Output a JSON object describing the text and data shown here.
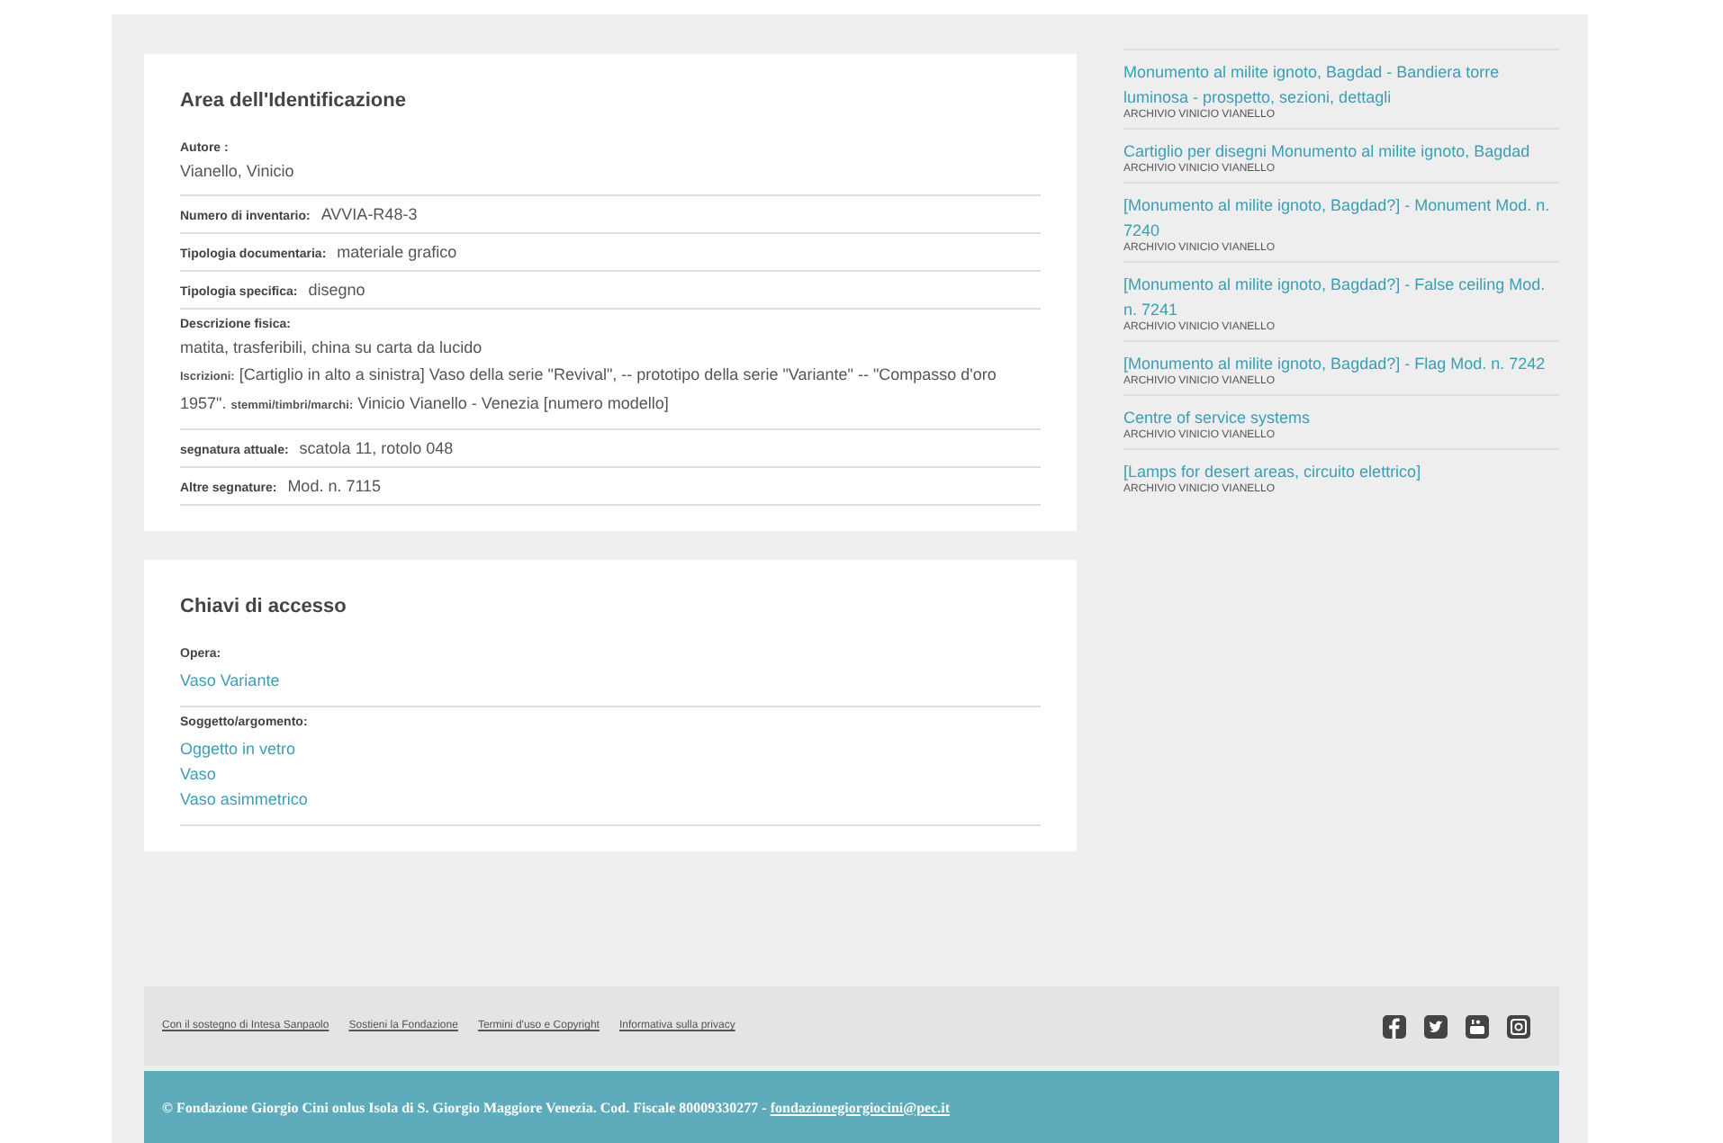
{
  "identification": {
    "title": "Area dell'Identificazione",
    "fields": [
      {
        "kind": "block",
        "label": "Autore :",
        "value": "Vianello, Vinicio"
      },
      {
        "kind": "inline",
        "label": "Numero di inventario:",
        "value": "AVVIA-R48-3"
      },
      {
        "kind": "inline",
        "label": "Tipologia documentaria:",
        "value": "materiale grafico"
      },
      {
        "kind": "inline",
        "label": "Tipologia specifica:",
        "value": "disegno"
      },
      {
        "kind": "description",
        "label": "Descrizione fisica:",
        "value": "matita, trasferibili, china su carta da lucido",
        "note": "**Iscrizioni:**  [Cartiglio in alto a sinistra] Vaso della serie \"Revival\", -- prototipo della serie \"Variante\" -- \"Compasso d'oro 1957\". **stemmi/timbri/marchi:**  Vinicio Vianello - Venezia [numero modello]"
      },
      {
        "kind": "inline",
        "label": "segnatura attuale:",
        "value": "scatola 11, rotolo 048"
      },
      {
        "kind": "inline",
        "label": "Altre segnature:",
        "value": "Mod. n. 7115"
      }
    ]
  },
  "access_keys": {
    "title": "Chiavi di accesso",
    "groups": [
      {
        "label": "Opera:",
        "links": [
          "Vaso Variante"
        ]
      },
      {
        "label": "Soggetto/argomento:",
        "links": [
          "Oggetto in vetro",
          "Vaso",
          "Vaso asimmetrico"
        ]
      }
    ]
  },
  "related": [
    {
      "title": "Monumento al milite ignoto, Bagdad - Bandiera torre luminosa - prospetto, sezioni, dettagli",
      "source": "ARCHIVIO VINICIO VIANELLO"
    },
    {
      "title": "Cartiglio per disegni Monumento al milite ignoto, Bagdad",
      "source": "ARCHIVIO VINICIO VIANELLO"
    },
    {
      "title": "[Monumento al milite ignoto, Bagdad?] - Monument Mod. n. 7240",
      "source": "ARCHIVIO VINICIO VIANELLO"
    },
    {
      "title": "[Monumento al milite ignoto, Bagdad?] - False ceiling Mod. n. 7241",
      "source": "ARCHIVIO VINICIO VIANELLO"
    },
    {
      "title": "[Monumento al milite ignoto, Bagdad?] - Flag Mod. n. 7242",
      "source": "ARCHIVIO VINICIO VIANELLO"
    },
    {
      "title": "Centre of service systems",
      "source": "ARCHIVIO VINICIO VIANELLO"
    },
    {
      "title": "[Lamps for desert areas, circuito elettrico]",
      "source": "ARCHIVIO VINICIO VIANELLO"
    }
  ],
  "footer": {
    "links": [
      "Con il sostegno di Intesa Sanpaolo",
      "Sostieni la Fondazione",
      "Termini d'uso e Copyright",
      "Informativa sulla privacy"
    ],
    "social": [
      {
        "kind": "facebook"
      },
      {
        "kind": "twitter"
      },
      {
        "kind": "youtube"
      },
      {
        "kind": "instagram"
      }
    ],
    "copyright": "© Fondazione Giorgio Cini onlus Isola di S. Giorgio Maggiore Venezia. Cod. Fiscale 80009330277 - ",
    "email": "fondazionegiorgiocini@pec.it"
  }
}
